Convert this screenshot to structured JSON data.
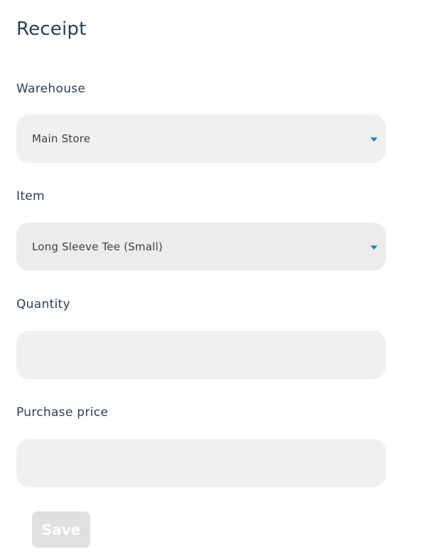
{
  "page": {
    "title": "Receipt"
  },
  "form": {
    "warehouse": {
      "label": "Warehouse",
      "value": "Main Store"
    },
    "item": {
      "label": "Item",
      "value": "Long Sleeve Tee (Small)"
    },
    "quantity": {
      "label": "Quantity",
      "value": ""
    },
    "purchase_price": {
      "label": "Purchase price",
      "value": ""
    },
    "save_label": "Save"
  },
  "icons": {
    "dropdown": "chevron-down-icon"
  },
  "colors": {
    "accent": "#1c87c9",
    "field_bg": "#f0f0f0",
    "text": "#2c3e55",
    "button_disabled_bg": "#e0e0e0"
  }
}
